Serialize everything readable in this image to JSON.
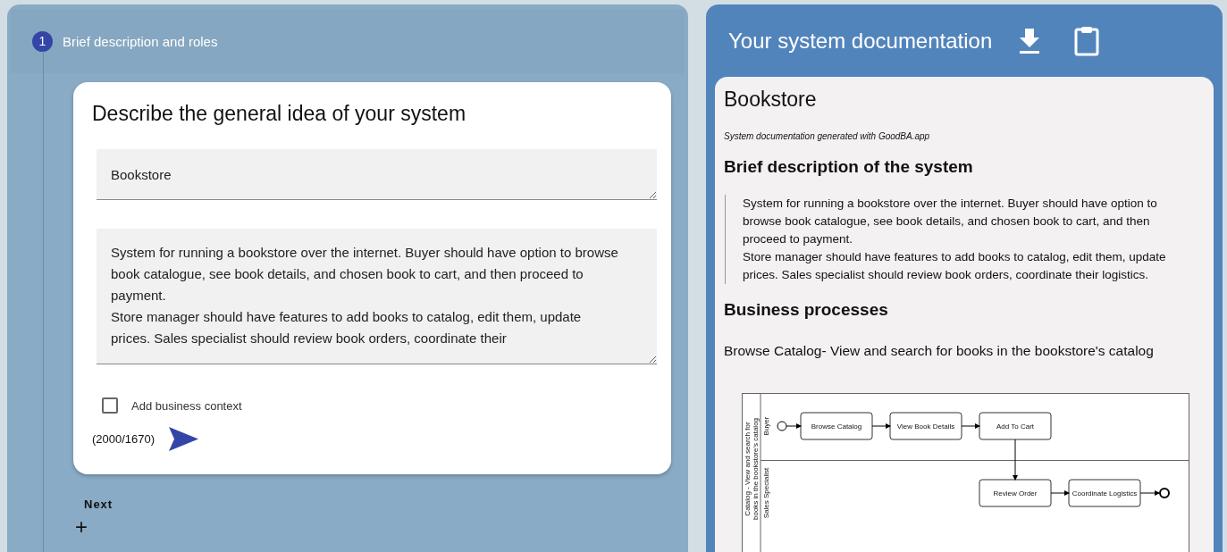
{
  "stepper": {
    "step": {
      "number": "1",
      "label": "Brief description and roles"
    },
    "card": {
      "title": "Describe the general idea of your system",
      "name_field": {
        "value": "Bookstore"
      },
      "description_field": {
        "value": "System for running a bookstore over the internet. Buyer should have option to browse book catalogue, see book details, and chosen book to cart, and then proceed to payment.\nStore manager should have features to add books to catalog, edit them, update prices. Sales specialist should review book orders, coordinate their"
      },
      "business_context": {
        "label": "Add business context",
        "checked": false
      },
      "counter": "(2000/1670)"
    },
    "next_button": "Next",
    "add_button": "+"
  },
  "documentation": {
    "title": "Your system documentation",
    "doc_title": "Bookstore",
    "subtitle": "System documentation generated with GoodBA.app",
    "sections": [
      {
        "kind": "heading",
        "text": "Brief description of the system"
      },
      {
        "kind": "quote",
        "lines": [
          "System for running a bookstore over the internet. Buyer should have option to browse book catalogue, see book details, and chosen book to cart, and then proceed to payment.",
          "Store manager should have features to add books to catalog, edit them, update prices. Sales specialist should review book orders, coordinate their logistics."
        ]
      },
      {
        "kind": "heading",
        "text": "Business processes"
      },
      {
        "kind": "paragraph",
        "text": "Browse Catalog- View and search for books in the bookstore's catalog"
      }
    ],
    "diagram": {
      "pool_label": "Catalog - View and search for books in the bookstore's catalog",
      "lanes": [
        {
          "label": "Buyer",
          "tasks": [
            {
              "label": "Browse Catalog"
            },
            {
              "label": "View Book Details"
            },
            {
              "label": "Add To Cart"
            }
          ]
        },
        {
          "label": "Sales Specialist",
          "tasks": [
            {
              "label": "Review Order"
            },
            {
              "label": "Coordinate Logistics"
            }
          ]
        }
      ]
    }
  }
}
